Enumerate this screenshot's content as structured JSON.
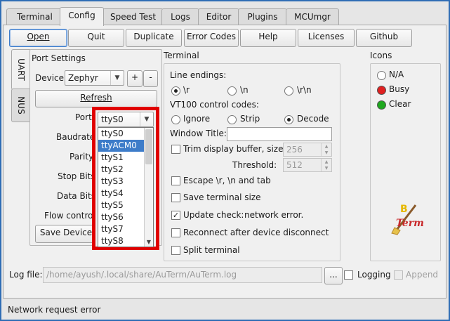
{
  "tabs": [
    "Terminal",
    "Config",
    "Speed Test",
    "Logs",
    "Editor",
    "Plugins",
    "MCUmgr"
  ],
  "toolbar": [
    "Open",
    "Quit",
    "Duplicate",
    "Error Codes",
    "Help",
    "Licenses",
    "Github"
  ],
  "side_tabs": [
    "UART",
    "NUS"
  ],
  "port_settings": {
    "title": "Port Settings",
    "device_label": "Device",
    "device_value": "Zephyr",
    "plus": "+",
    "minus": "-",
    "refresh": "Refresh",
    "port_label": "Port",
    "port_value": "ttyS0",
    "baudrate_label": "Baudrate",
    "parity_label": "Parity",
    "stopbits_label": "Stop Bits",
    "databits_label": "Data Bits",
    "flow_label": "Flow control",
    "save_device": "Save Device"
  },
  "port_dropdown": {
    "items": [
      "ttyS0",
      "ttyACM0",
      "ttyS1",
      "ttyS2",
      "ttyS3",
      "ttyS4",
      "ttyS5",
      "ttyS6",
      "ttyS7",
      "ttyS8"
    ],
    "selected": "ttyACM0",
    "highlight_color": "#e00000"
  },
  "terminal": {
    "title": "Terminal",
    "line_endings_label": "Line endings:",
    "line_endings": [
      "\\r",
      "\\n",
      "\\r\\n"
    ],
    "line_endings_selected": "\\r",
    "vt100_label": "VT100 control codes:",
    "vt100": [
      "Ignore",
      "Strip",
      "Decode"
    ],
    "vt100_selected": "Decode",
    "window_title_label": "Window Title:",
    "window_title_value": "",
    "trim_label": "Trim display buffer, size:",
    "trim_value": "256",
    "threshold_label": "Threshold:",
    "threshold_value": "512",
    "escape_label": "Escape \\r, \\n and tab",
    "save_size_label": "Save terminal size",
    "update_check_label": "Update check:",
    "update_check_status": "network error.",
    "reconnect_label": "Reconnect after device disconnect",
    "split_label": "Split terminal",
    "checks": {
      "trim": false,
      "escape": false,
      "save_size": false,
      "update_check": true,
      "reconnect": false,
      "split": false
    }
  },
  "icons": {
    "title": "Icons",
    "options": [
      {
        "label": "N/A",
        "color": "#ffffff"
      },
      {
        "label": "Busy",
        "color": "#e02020"
      },
      {
        "label": "Clear",
        "color": "#1fa81f"
      }
    ],
    "logo_text": "B",
    "logo_word": "Term"
  },
  "log": {
    "label": "Log file:",
    "path": "/home/ayush/.local/share/AuTerm/AuTerm.log",
    "browse": "...",
    "logging_label": "Logging",
    "append_label": "Append"
  },
  "status_bar": "Network request error"
}
